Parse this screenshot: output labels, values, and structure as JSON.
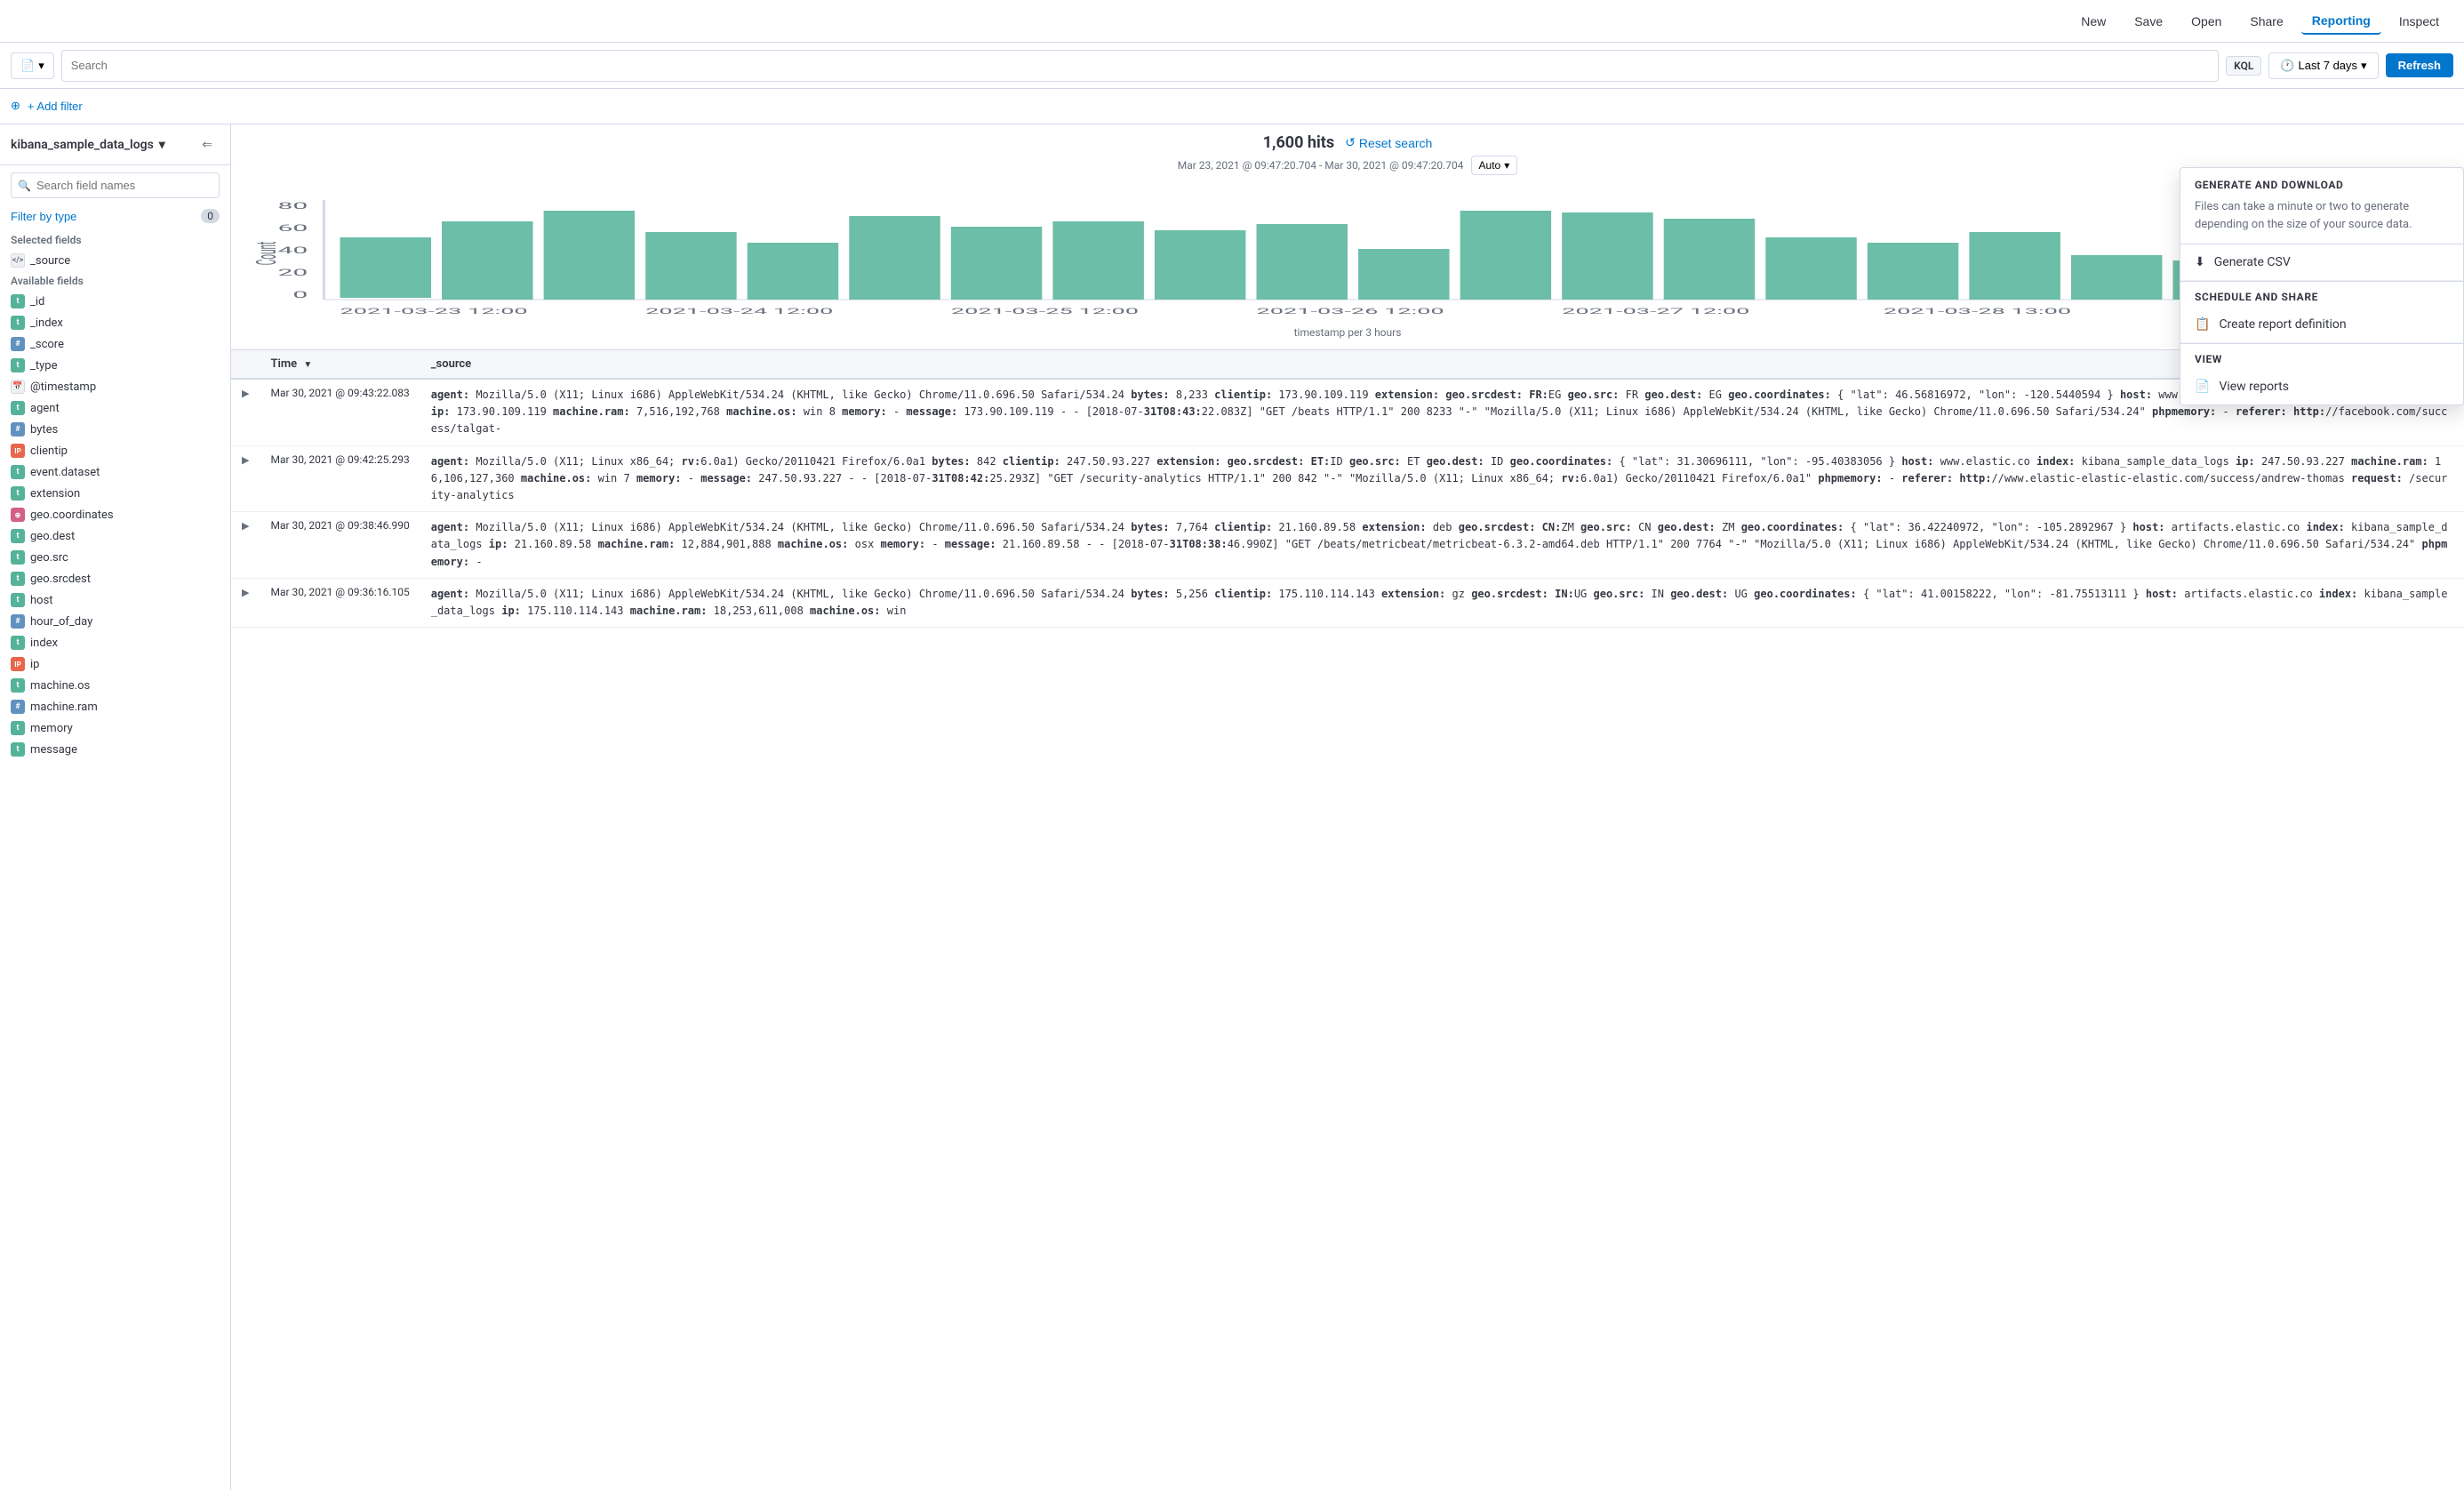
{
  "topNav": {
    "buttons": [
      {
        "id": "new",
        "label": "New"
      },
      {
        "id": "save",
        "label": "Save"
      },
      {
        "id": "open",
        "label": "Open"
      },
      {
        "id": "share",
        "label": "Share"
      },
      {
        "id": "reporting",
        "label": "Reporting",
        "active": true
      },
      {
        "id": "inspect",
        "label": "Inspect"
      }
    ]
  },
  "searchBar": {
    "placeholder": "Search",
    "kqlLabel": "KQL",
    "timeLabel": "Last 7 days",
    "refreshLabel": "Refresh"
  },
  "filterRow": {
    "addFilterLabel": "+ Add filter"
  },
  "sidebar": {
    "indexPattern": "kibana_sample_data_logs",
    "searchPlaceholder": "Search field names",
    "filterByTypeLabel": "Filter by type",
    "filterCount": "0",
    "selectedFieldsLabel": "Selected fields",
    "selectedFields": [
      {
        "name": "_source",
        "type": "source"
      }
    ],
    "availableFieldsLabel": "Available fields",
    "availableFields": [
      {
        "name": "_id",
        "type": "t"
      },
      {
        "name": "_index",
        "type": "t"
      },
      {
        "name": "_score",
        "type": "hash"
      },
      {
        "name": "_type",
        "type": "t"
      },
      {
        "name": "@timestamp",
        "type": "cal"
      },
      {
        "name": "agent",
        "type": "t"
      },
      {
        "name": "bytes",
        "type": "hash"
      },
      {
        "name": "clientip",
        "type": "ip"
      },
      {
        "name": "event.dataset",
        "type": "t"
      },
      {
        "name": "extension",
        "type": "t"
      },
      {
        "name": "geo.coordinates",
        "type": "geo"
      },
      {
        "name": "geo.dest",
        "type": "t"
      },
      {
        "name": "geo.src",
        "type": "t"
      },
      {
        "name": "geo.srcdest",
        "type": "t"
      },
      {
        "name": "host",
        "type": "t"
      },
      {
        "name": "hour_of_day",
        "type": "num"
      },
      {
        "name": "index",
        "type": "t"
      },
      {
        "name": "ip",
        "type": "ip"
      },
      {
        "name": "machine.os",
        "type": "t"
      },
      {
        "name": "machine.ram",
        "type": "hash"
      },
      {
        "name": "memory",
        "type": "t"
      },
      {
        "name": "message",
        "type": "t"
      }
    ]
  },
  "chart": {
    "yAxisLabel": "Count",
    "xAxisLabel": "timestamp per 3 hours",
    "hitsCount": "1,600 hits",
    "resetSearchLabel": "Reset search",
    "dateRange": "Mar 23, 2021 @ 09:47:20.704 - Mar 30, 2021 @ 09:47:20.704",
    "autoLabel": "Auto",
    "bars": [
      {
        "x": 0,
        "h": 55,
        "label": "2021-03-23 12:00"
      },
      {
        "x": 1,
        "h": 70,
        "label": ""
      },
      {
        "x": 2,
        "h": 80,
        "label": ""
      },
      {
        "x": 3,
        "h": 60,
        "label": "2021-03-24 12:00"
      },
      {
        "x": 4,
        "h": 50,
        "label": ""
      },
      {
        "x": 5,
        "h": 75,
        "label": ""
      },
      {
        "x": 6,
        "h": 65,
        "label": "2021-03-25 12:00"
      },
      {
        "x": 7,
        "h": 70,
        "label": ""
      },
      {
        "x": 8,
        "h": 62,
        "label": ""
      },
      {
        "x": 9,
        "h": 68,
        "label": "2021-03-26 12:00"
      },
      {
        "x": 10,
        "h": 45,
        "label": ""
      },
      {
        "x": 11,
        "h": 80,
        "label": ""
      },
      {
        "x": 12,
        "h": 78,
        "label": "2021-03-27 12:00"
      },
      {
        "x": 13,
        "h": 72,
        "label": ""
      },
      {
        "x": 14,
        "h": 55,
        "label": ""
      },
      {
        "x": 15,
        "h": 50,
        "label": "2021-03-28 13:00"
      },
      {
        "x": 16,
        "h": 60,
        "label": ""
      },
      {
        "x": 17,
        "h": 40,
        "label": ""
      },
      {
        "x": 18,
        "h": 35,
        "label": ""
      }
    ],
    "yTicks": [
      0,
      20,
      40,
      60,
      80
    ],
    "xLabels": [
      "2021-03-23 12:00",
      "2021-03-24 12:00",
      "2021-03-25 12:00",
      "2021-03-26 12:00",
      "2021-03-27 12:00",
      "2021-03-28 13:00"
    ]
  },
  "table": {
    "columns": [
      {
        "id": "expand",
        "label": ""
      },
      {
        "id": "time",
        "label": "Time"
      },
      {
        "id": "source",
        "label": "_source"
      }
    ],
    "rows": [
      {
        "time": "Mar 30, 2021 @ 09:43:22.083",
        "source": "agent: Mozilla/5.0 (X11; Linux i686) AppleWebKit/534.24 (KHTML, like Gecko) Chrome/11.0.696.50 Safari/534.24 bytes: 8,233 clientip: 173.90.109.119 extension: geo.srcdest: FR:EG geo.src: FR geo.dest: EG geo.coordinates: { \"lat\": 46.56816972, \"lon\": -120.5440594 } host: www.elastic.co index: kibana_sample_data_logs ip: 173.90.109.119 machine.ram: 7,516,192,768 machine.os: win 8 memory: - message: 173.90.109.119 - - [2018-07-31T08:43:22.083Z] \"GET /beats HTTP/1.1\" 200 8233 \"-\" \"Mozilla/5.0 (X11; Linux i686) AppleWebKit/534.24 (KHTML, like Gecko) Chrome/11.0.696.50 Safari/534.24\" phpmemory: - referer: http://facebook.com/success/talgat-"
      },
      {
        "time": "Mar 30, 2021 @ 09:42:25.293",
        "source": "agent: Mozilla/5.0 (X11; Linux x86_64; rv:6.0a1) Gecko/20110421 Firefox/6.0a1 bytes: 842 clientip: 247.50.93.227 extension: geo.srcdest: ET:ID geo.src: ET geo.dest: ID geo.coordinates: { \"lat\": 31.30696111, \"lon\": -95.40383056 } host: www.elastic.co index: kibana_sample_data_logs ip: 247.50.93.227 machine.ram: 16,106,127,360 machine.os: win 7 memory: - message: 247.50.93.227 - - [2018-07-31T08:42:25.293Z] \"GET /security-analytics HTTP/1.1\" 200 842 \"-\" \"Mozilla/5.0 (X11; Linux x86_64; rv:6.0a1) Gecko/20110421 Firefox/6.0a1\" phpmemory: - referer: http://www.elastic-elastic-elastic.com/success/andrew-thomas request: /security-analytics"
      },
      {
        "time": "Mar 30, 2021 @ 09:38:46.990",
        "source": "agent: Mozilla/5.0 (X11; Linux i686) AppleWebKit/534.24 (KHTML, like Gecko) Chrome/11.0.696.50 Safari/534.24 bytes: 7,764 clientip: 21.160.89.58 extension: deb geo.srcdest: CN:ZM geo.src: CN geo.dest: ZM geo.coordinates: { \"lat\": 36.42240972, \"lon\": -105.2892967 } host: artifacts.elastic.co index: kibana_sample_data_logs ip: 21.160.89.58 machine.ram: 12,884,901,888 machine.os: osx memory: - message: 21.160.89.58 - - [2018-07-31T08:38:46.990Z] \"GET /beats/metricbeat/metricbeat-6.3.2-amd64.deb HTTP/1.1\" 200 7764 \"-\" \"Mozilla/5.0 (X11; Linux i686) AppleWebKit/534.24 (KHTML, like Gecko) Chrome/11.0.696.50 Safari/534.24\" phpmemory: -"
      },
      {
        "time": "Mar 30, 2021 @ 09:36:16.105",
        "source": "agent: Mozilla/5.0 (X11; Linux i686) AppleWebKit/534.24 (KHTML, like Gecko) Chrome/11.0.696.50 Safari/534.24 bytes: 5,256 clientip: 175.110.114.143 extension: gz geo.srcdest: IN:UG geo.src: IN geo.dest: UG geo.coordinates: { \"lat\": 41.00158222, \"lon\": -81.75513111 } host: artifacts.elastic.co index: kibana_sample_data_logs ip: 175.110.114.143 machine.ram: 18,253,611,008 machine.os: win"
      }
    ]
  },
  "reporting": {
    "dropdownTitle": "GENERATE AND DOWNLOAD",
    "dropdownDesc": "Files can take a minute or two to generate depending on the size of your source data.",
    "generateCsvLabel": "Generate CSV",
    "scheduleShareTitle": "SCHEDULE AND SHARE",
    "createReportLabel": "Create report definition",
    "viewTitle": "VIEW",
    "viewReportsLabel": "View reports"
  },
  "colors": {
    "accent": "#0077cc",
    "chartBar": "#54b399",
    "border": "#d3dae6",
    "bgLight": "#f5f7fa"
  }
}
